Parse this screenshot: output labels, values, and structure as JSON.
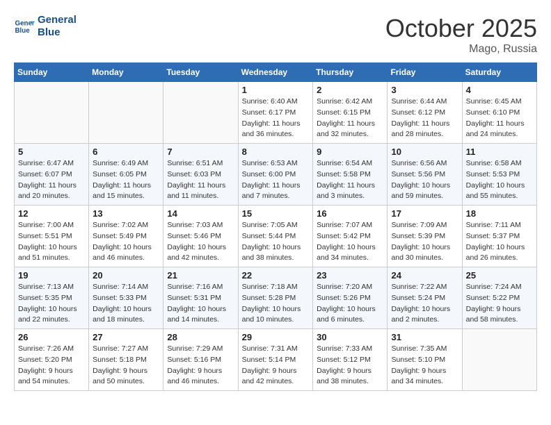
{
  "header": {
    "logo_line1": "General",
    "logo_line2": "Blue",
    "month": "October 2025",
    "location": "Mago, Russia"
  },
  "weekdays": [
    "Sunday",
    "Monday",
    "Tuesday",
    "Wednesday",
    "Thursday",
    "Friday",
    "Saturday"
  ],
  "weeks": [
    [
      {
        "day": "",
        "info": ""
      },
      {
        "day": "",
        "info": ""
      },
      {
        "day": "",
        "info": ""
      },
      {
        "day": "1",
        "info": "Sunrise: 6:40 AM\nSunset: 6:17 PM\nDaylight: 11 hours\nand 36 minutes."
      },
      {
        "day": "2",
        "info": "Sunrise: 6:42 AM\nSunset: 6:15 PM\nDaylight: 11 hours\nand 32 minutes."
      },
      {
        "day": "3",
        "info": "Sunrise: 6:44 AM\nSunset: 6:12 PM\nDaylight: 11 hours\nand 28 minutes."
      },
      {
        "day": "4",
        "info": "Sunrise: 6:45 AM\nSunset: 6:10 PM\nDaylight: 11 hours\nand 24 minutes."
      }
    ],
    [
      {
        "day": "5",
        "info": "Sunrise: 6:47 AM\nSunset: 6:07 PM\nDaylight: 11 hours\nand 20 minutes."
      },
      {
        "day": "6",
        "info": "Sunrise: 6:49 AM\nSunset: 6:05 PM\nDaylight: 11 hours\nand 15 minutes."
      },
      {
        "day": "7",
        "info": "Sunrise: 6:51 AM\nSunset: 6:03 PM\nDaylight: 11 hours\nand 11 minutes."
      },
      {
        "day": "8",
        "info": "Sunrise: 6:53 AM\nSunset: 6:00 PM\nDaylight: 11 hours\nand 7 minutes."
      },
      {
        "day": "9",
        "info": "Sunrise: 6:54 AM\nSunset: 5:58 PM\nDaylight: 11 hours\nand 3 minutes."
      },
      {
        "day": "10",
        "info": "Sunrise: 6:56 AM\nSunset: 5:56 PM\nDaylight: 10 hours\nand 59 minutes."
      },
      {
        "day": "11",
        "info": "Sunrise: 6:58 AM\nSunset: 5:53 PM\nDaylight: 10 hours\nand 55 minutes."
      }
    ],
    [
      {
        "day": "12",
        "info": "Sunrise: 7:00 AM\nSunset: 5:51 PM\nDaylight: 10 hours\nand 51 minutes."
      },
      {
        "day": "13",
        "info": "Sunrise: 7:02 AM\nSunset: 5:49 PM\nDaylight: 10 hours\nand 46 minutes."
      },
      {
        "day": "14",
        "info": "Sunrise: 7:03 AM\nSunset: 5:46 PM\nDaylight: 10 hours\nand 42 minutes."
      },
      {
        "day": "15",
        "info": "Sunrise: 7:05 AM\nSunset: 5:44 PM\nDaylight: 10 hours\nand 38 minutes."
      },
      {
        "day": "16",
        "info": "Sunrise: 7:07 AM\nSunset: 5:42 PM\nDaylight: 10 hours\nand 34 minutes."
      },
      {
        "day": "17",
        "info": "Sunrise: 7:09 AM\nSunset: 5:39 PM\nDaylight: 10 hours\nand 30 minutes."
      },
      {
        "day": "18",
        "info": "Sunrise: 7:11 AM\nSunset: 5:37 PM\nDaylight: 10 hours\nand 26 minutes."
      }
    ],
    [
      {
        "day": "19",
        "info": "Sunrise: 7:13 AM\nSunset: 5:35 PM\nDaylight: 10 hours\nand 22 minutes."
      },
      {
        "day": "20",
        "info": "Sunrise: 7:14 AM\nSunset: 5:33 PM\nDaylight: 10 hours\nand 18 minutes."
      },
      {
        "day": "21",
        "info": "Sunrise: 7:16 AM\nSunset: 5:31 PM\nDaylight: 10 hours\nand 14 minutes."
      },
      {
        "day": "22",
        "info": "Sunrise: 7:18 AM\nSunset: 5:28 PM\nDaylight: 10 hours\nand 10 minutes."
      },
      {
        "day": "23",
        "info": "Sunrise: 7:20 AM\nSunset: 5:26 PM\nDaylight: 10 hours\nand 6 minutes."
      },
      {
        "day": "24",
        "info": "Sunrise: 7:22 AM\nSunset: 5:24 PM\nDaylight: 10 hours\nand 2 minutes."
      },
      {
        "day": "25",
        "info": "Sunrise: 7:24 AM\nSunset: 5:22 PM\nDaylight: 9 hours\nand 58 minutes."
      }
    ],
    [
      {
        "day": "26",
        "info": "Sunrise: 7:26 AM\nSunset: 5:20 PM\nDaylight: 9 hours\nand 54 minutes."
      },
      {
        "day": "27",
        "info": "Sunrise: 7:27 AM\nSunset: 5:18 PM\nDaylight: 9 hours\nand 50 minutes."
      },
      {
        "day": "28",
        "info": "Sunrise: 7:29 AM\nSunset: 5:16 PM\nDaylight: 9 hours\nand 46 minutes."
      },
      {
        "day": "29",
        "info": "Sunrise: 7:31 AM\nSunset: 5:14 PM\nDaylight: 9 hours\nand 42 minutes."
      },
      {
        "day": "30",
        "info": "Sunrise: 7:33 AM\nSunset: 5:12 PM\nDaylight: 9 hours\nand 38 minutes."
      },
      {
        "day": "31",
        "info": "Sunrise: 7:35 AM\nSunset: 5:10 PM\nDaylight: 9 hours\nand 34 minutes."
      },
      {
        "day": "",
        "info": ""
      }
    ]
  ]
}
